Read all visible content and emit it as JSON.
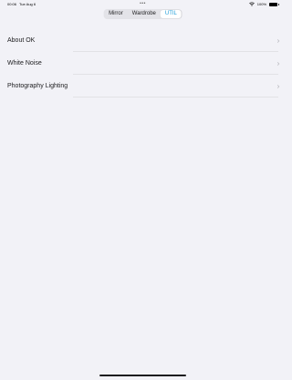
{
  "status_bar": {
    "time": "00:06",
    "date": "Tue Aug 6",
    "center_dots": "•••",
    "battery_percent": "100%"
  },
  "segmented_control": {
    "items": [
      {
        "label": "Mirror",
        "selected": false
      },
      {
        "label": "Wardrobe",
        "selected": false
      },
      {
        "label": "UTIL",
        "selected": true
      }
    ],
    "accent_color": "#1a9bd7"
  },
  "list": {
    "items": [
      {
        "label": "About OK"
      },
      {
        "label": "White Noise"
      },
      {
        "label": "Photography Lighting"
      }
    ]
  }
}
